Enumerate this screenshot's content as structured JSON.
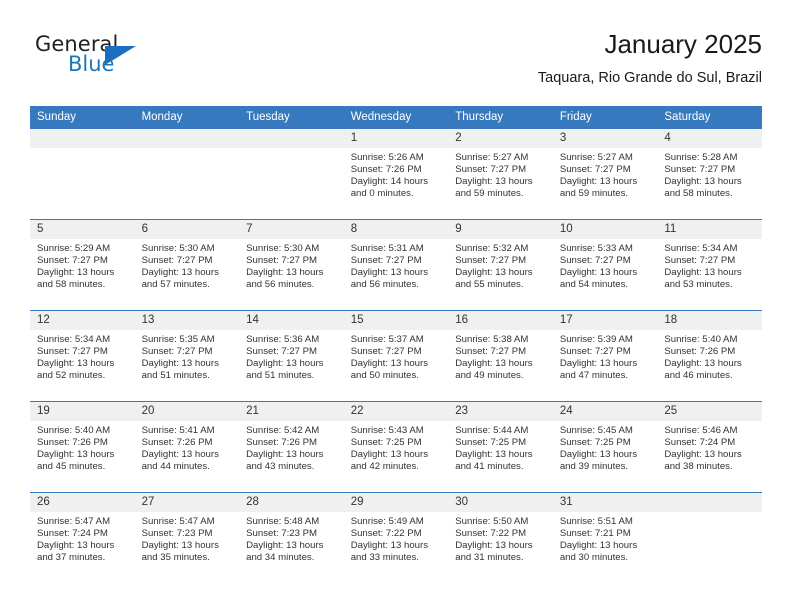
{
  "brand": {
    "name_part1": "General",
    "name_part2": "Blue",
    "logo_icon": "triangle-logo-icon",
    "accent_color": "#1b6fc0"
  },
  "header": {
    "month_title": "January 2025",
    "location": "Taquara, Rio Grande do Sul, Brazil"
  },
  "calendar": {
    "header_bg": "#3679bf",
    "daynum_bg": "#f0f0f0",
    "weekdays": [
      "Sunday",
      "Monday",
      "Tuesday",
      "Wednesday",
      "Thursday",
      "Friday",
      "Saturday"
    ],
    "weeks": [
      [
        {
          "day": "",
          "empty": true
        },
        {
          "day": "",
          "empty": true
        },
        {
          "day": "",
          "empty": true
        },
        {
          "day": "1",
          "sunrise": "Sunrise: 5:26 AM",
          "sunset": "Sunset: 7:26 PM",
          "daylight_line1": "Daylight: 14 hours",
          "daylight_line2": "and 0 minutes."
        },
        {
          "day": "2",
          "sunrise": "Sunrise: 5:27 AM",
          "sunset": "Sunset: 7:27 PM",
          "daylight_line1": "Daylight: 13 hours",
          "daylight_line2": "and 59 minutes."
        },
        {
          "day": "3",
          "sunrise": "Sunrise: 5:27 AM",
          "sunset": "Sunset: 7:27 PM",
          "daylight_line1": "Daylight: 13 hours",
          "daylight_line2": "and 59 minutes."
        },
        {
          "day": "4",
          "sunrise": "Sunrise: 5:28 AM",
          "sunset": "Sunset: 7:27 PM",
          "daylight_line1": "Daylight: 13 hours",
          "daylight_line2": "and 58 minutes."
        }
      ],
      [
        {
          "day": "5",
          "sunrise": "Sunrise: 5:29 AM",
          "sunset": "Sunset: 7:27 PM",
          "daylight_line1": "Daylight: 13 hours",
          "daylight_line2": "and 58 minutes."
        },
        {
          "day": "6",
          "sunrise": "Sunrise: 5:30 AM",
          "sunset": "Sunset: 7:27 PM",
          "daylight_line1": "Daylight: 13 hours",
          "daylight_line2": "and 57 minutes."
        },
        {
          "day": "7",
          "sunrise": "Sunrise: 5:30 AM",
          "sunset": "Sunset: 7:27 PM",
          "daylight_line1": "Daylight: 13 hours",
          "daylight_line2": "and 56 minutes."
        },
        {
          "day": "8",
          "sunrise": "Sunrise: 5:31 AM",
          "sunset": "Sunset: 7:27 PM",
          "daylight_line1": "Daylight: 13 hours",
          "daylight_line2": "and 56 minutes."
        },
        {
          "day": "9",
          "sunrise": "Sunrise: 5:32 AM",
          "sunset": "Sunset: 7:27 PM",
          "daylight_line1": "Daylight: 13 hours",
          "daylight_line2": "and 55 minutes."
        },
        {
          "day": "10",
          "sunrise": "Sunrise: 5:33 AM",
          "sunset": "Sunset: 7:27 PM",
          "daylight_line1": "Daylight: 13 hours",
          "daylight_line2": "and 54 minutes."
        },
        {
          "day": "11",
          "sunrise": "Sunrise: 5:34 AM",
          "sunset": "Sunset: 7:27 PM",
          "daylight_line1": "Daylight: 13 hours",
          "daylight_line2": "and 53 minutes."
        }
      ],
      [
        {
          "day": "12",
          "sunrise": "Sunrise: 5:34 AM",
          "sunset": "Sunset: 7:27 PM",
          "daylight_line1": "Daylight: 13 hours",
          "daylight_line2": "and 52 minutes."
        },
        {
          "day": "13",
          "sunrise": "Sunrise: 5:35 AM",
          "sunset": "Sunset: 7:27 PM",
          "daylight_line1": "Daylight: 13 hours",
          "daylight_line2": "and 51 minutes."
        },
        {
          "day": "14",
          "sunrise": "Sunrise: 5:36 AM",
          "sunset": "Sunset: 7:27 PM",
          "daylight_line1": "Daylight: 13 hours",
          "daylight_line2": "and 51 minutes."
        },
        {
          "day": "15",
          "sunrise": "Sunrise: 5:37 AM",
          "sunset": "Sunset: 7:27 PM",
          "daylight_line1": "Daylight: 13 hours",
          "daylight_line2": "and 50 minutes."
        },
        {
          "day": "16",
          "sunrise": "Sunrise: 5:38 AM",
          "sunset": "Sunset: 7:27 PM",
          "daylight_line1": "Daylight: 13 hours",
          "daylight_line2": "and 49 minutes."
        },
        {
          "day": "17",
          "sunrise": "Sunrise: 5:39 AM",
          "sunset": "Sunset: 7:27 PM",
          "daylight_line1": "Daylight: 13 hours",
          "daylight_line2": "and 47 minutes."
        },
        {
          "day": "18",
          "sunrise": "Sunrise: 5:40 AM",
          "sunset": "Sunset: 7:26 PM",
          "daylight_line1": "Daylight: 13 hours",
          "daylight_line2": "and 46 minutes."
        }
      ],
      [
        {
          "day": "19",
          "sunrise": "Sunrise: 5:40 AM",
          "sunset": "Sunset: 7:26 PM",
          "daylight_line1": "Daylight: 13 hours",
          "daylight_line2": "and 45 minutes."
        },
        {
          "day": "20",
          "sunrise": "Sunrise: 5:41 AM",
          "sunset": "Sunset: 7:26 PM",
          "daylight_line1": "Daylight: 13 hours",
          "daylight_line2": "and 44 minutes."
        },
        {
          "day": "21",
          "sunrise": "Sunrise: 5:42 AM",
          "sunset": "Sunset: 7:26 PM",
          "daylight_line1": "Daylight: 13 hours",
          "daylight_line2": "and 43 minutes."
        },
        {
          "day": "22",
          "sunrise": "Sunrise: 5:43 AM",
          "sunset": "Sunset: 7:25 PM",
          "daylight_line1": "Daylight: 13 hours",
          "daylight_line2": "and 42 minutes."
        },
        {
          "day": "23",
          "sunrise": "Sunrise: 5:44 AM",
          "sunset": "Sunset: 7:25 PM",
          "daylight_line1": "Daylight: 13 hours",
          "daylight_line2": "and 41 minutes."
        },
        {
          "day": "24",
          "sunrise": "Sunrise: 5:45 AM",
          "sunset": "Sunset: 7:25 PM",
          "daylight_line1": "Daylight: 13 hours",
          "daylight_line2": "and 39 minutes."
        },
        {
          "day": "25",
          "sunrise": "Sunrise: 5:46 AM",
          "sunset": "Sunset: 7:24 PM",
          "daylight_line1": "Daylight: 13 hours",
          "daylight_line2": "and 38 minutes."
        }
      ],
      [
        {
          "day": "26",
          "sunrise": "Sunrise: 5:47 AM",
          "sunset": "Sunset: 7:24 PM",
          "daylight_line1": "Daylight: 13 hours",
          "daylight_line2": "and 37 minutes."
        },
        {
          "day": "27",
          "sunrise": "Sunrise: 5:47 AM",
          "sunset": "Sunset: 7:23 PM",
          "daylight_line1": "Daylight: 13 hours",
          "daylight_line2": "and 35 minutes."
        },
        {
          "day": "28",
          "sunrise": "Sunrise: 5:48 AM",
          "sunset": "Sunset: 7:23 PM",
          "daylight_line1": "Daylight: 13 hours",
          "daylight_line2": "and 34 minutes."
        },
        {
          "day": "29",
          "sunrise": "Sunrise: 5:49 AM",
          "sunset": "Sunset: 7:22 PM",
          "daylight_line1": "Daylight: 13 hours",
          "daylight_line2": "and 33 minutes."
        },
        {
          "day": "30",
          "sunrise": "Sunrise: 5:50 AM",
          "sunset": "Sunset: 7:22 PM",
          "daylight_line1": "Daylight: 13 hours",
          "daylight_line2": "and 31 minutes."
        },
        {
          "day": "31",
          "sunrise": "Sunrise: 5:51 AM",
          "sunset": "Sunset: 7:21 PM",
          "daylight_line1": "Daylight: 13 hours",
          "daylight_line2": "and 30 minutes."
        },
        {
          "day": "",
          "empty": true
        }
      ]
    ]
  }
}
